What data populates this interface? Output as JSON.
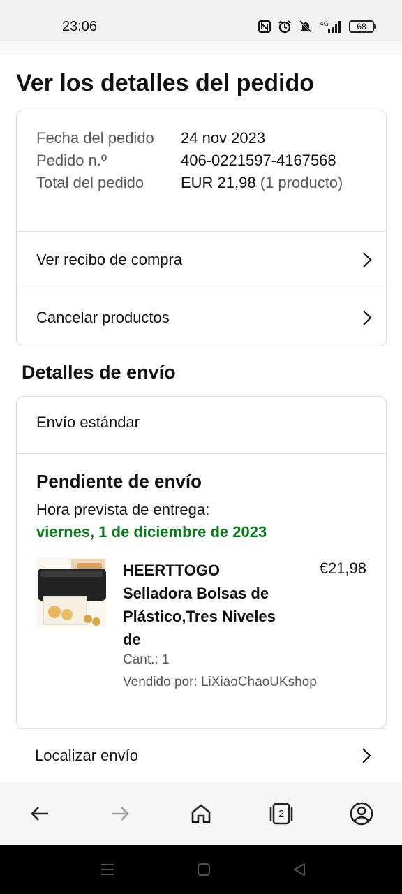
{
  "status_bar": {
    "time": "23:06",
    "icons": [
      "nfc-icon",
      "alarm-icon",
      "bell-muted-icon",
      "signal-4g-icon"
    ],
    "battery": "68"
  },
  "page": {
    "title": "Ver los detalles del pedido"
  },
  "order": {
    "rows": [
      {
        "label": "Fecha del pedido",
        "value": "24 nov 2023"
      },
      {
        "label": "Pedido n.º",
        "value": "406-0221597-4167568"
      },
      {
        "label": "Total del pedido",
        "value": "EUR 21,98",
        "extra": "(1 producto)"
      }
    ],
    "links": [
      "Ver recibo de compra",
      "Cancelar productos"
    ]
  },
  "shipping": {
    "section_title": "Detalles de envío",
    "type": "Envío estándar",
    "status": "Pendiente de envío",
    "eta_label": "Hora prevista de entrega:",
    "eta_date": "viernes, 1 de diciembre de 2023",
    "product": {
      "name": "HEERTTOGO Selladora Bolsas de Plástico,Tres Niveles de",
      "price": "€21,98",
      "qty": "Cant.: 1",
      "seller": "Vendido por: LiXiaoChaoUKshop"
    },
    "track_label": "Localizar envío"
  },
  "bottom_nav": {
    "icons": [
      "back-icon",
      "forward-icon",
      "home-icon",
      "tabs-icon",
      "account-icon"
    ],
    "tab_count": "2"
  },
  "colors": {
    "accent_green": "#067d1a",
    "muted_text": "#565959",
    "border": "#d5d9d9"
  }
}
